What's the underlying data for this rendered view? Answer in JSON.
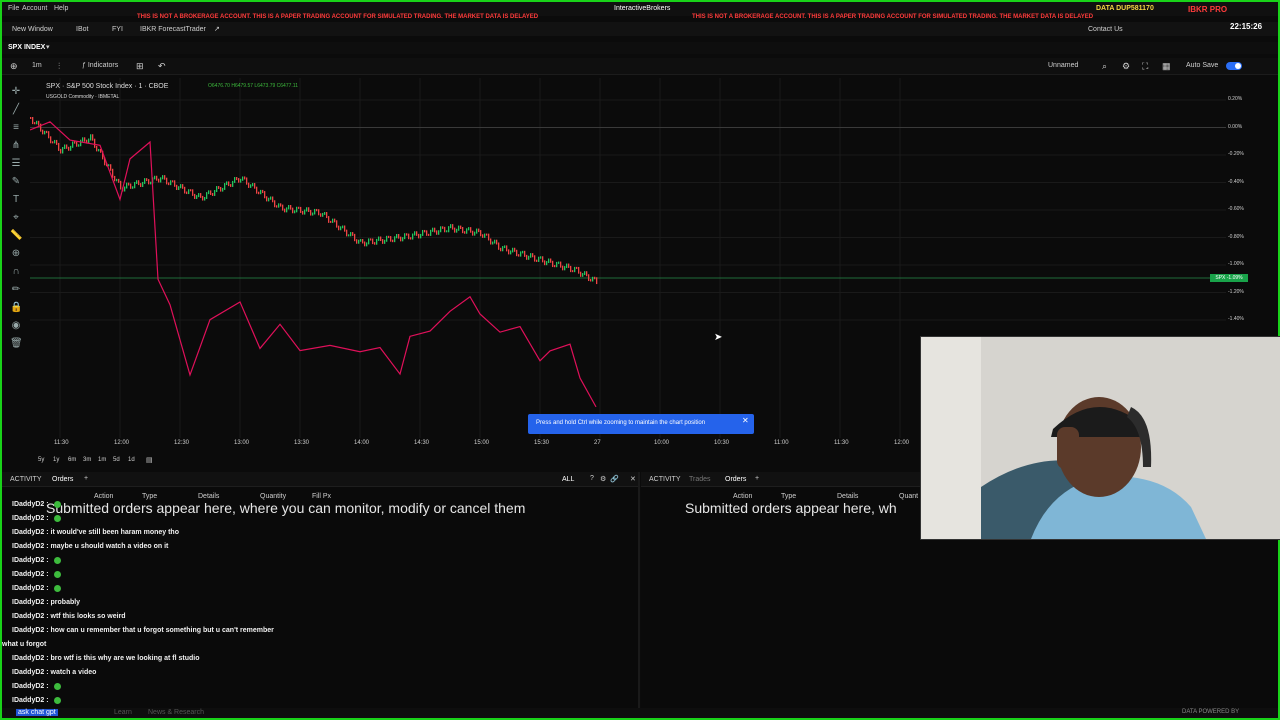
{
  "menubar": {
    "items": [
      "File",
      "Account",
      "Help"
    ],
    "app_title": "InteractiveBrokers",
    "banner": "THIS IS NOT A BROKERAGE ACCOUNT. THIS IS A PAPER TRADING ACCOUNT FOR SIMULATED TRADING. THE MARKET DATA IS DELAYED",
    "data_account": "DATA DUP581170",
    "brand": "IBKR PRO",
    "clock": "22:15:26"
  },
  "toolbar": {
    "items": [
      "New Window",
      "IBot",
      "FYI",
      "IBKR ForecastTrader"
    ],
    "contact": "Contact Us"
  },
  "tab": {
    "label": "SPX INDEX"
  },
  "chart_toolbar": {
    "interval": "1m",
    "indicators": "Indicators",
    "layout_name": "Unnamed",
    "autosave": "Auto Save"
  },
  "legend": {
    "main": "SPX · S&P 500 Stock Index · 1 · CBOE",
    "ohlc": "O6476.70  H6479.57  L6473.79  C6477.11",
    "overlay": "USGOLD Commodity · IBMETAL"
  },
  "price_scale": [
    "0.20%",
    "0.00%",
    "-0.20%",
    "-0.40%",
    "-0.60%",
    "-0.80%",
    "-1.00%",
    "-1.20%",
    "-1.40%"
  ],
  "price_tag": "SPX -1.09%",
  "time_axis": [
    "11:30",
    "12:00",
    "12:30",
    "13:00",
    "13:30",
    "14:00",
    "14:30",
    "15:00",
    "15:30",
    "27",
    "10:00",
    "10:30",
    "11:00",
    "11:30",
    "12:00"
  ],
  "range_buttons": [
    "5y",
    "1y",
    "6m",
    "3m",
    "1m",
    "5d",
    "1d"
  ],
  "tooltip": "Press and hold Ctrl while zooming to maintain the chart position",
  "left_panel": {
    "tabs": [
      "ACTIVITY",
      "Orders"
    ],
    "filter": "ALL",
    "columns": [
      "Action",
      "Type",
      "Details",
      "Quantity",
      "Fill Px"
    ],
    "empty_message": "Submitted orders appear here, where you can monitor, modify or cancel them"
  },
  "right_panel": {
    "tabs": [
      "ACTIVITY",
      "Trades",
      "Orders"
    ],
    "columns": [
      "Action",
      "Type",
      "Details",
      "Quant"
    ],
    "empty_message": "Submitted orders appear here, wh"
  },
  "chat": [
    {
      "user": "IDaddyD2 :",
      "msg": "",
      "emote": true
    },
    {
      "user": "IDaddyD2 :",
      "msg": "",
      "emote": true
    },
    {
      "user": "IDaddyD2 :",
      "msg": "it would've still been haram money tho",
      "emote": false
    },
    {
      "user": "IDaddyD2 :",
      "msg": "maybe u should watch a video on it",
      "emote": false
    },
    {
      "user": "IDaddyD2 :",
      "msg": "",
      "emote": true
    },
    {
      "user": "IDaddyD2 :",
      "msg": "",
      "emote": true
    },
    {
      "user": "IDaddyD2 :",
      "msg": "",
      "emote": true
    },
    {
      "user": "IDaddyD2 :",
      "msg": "probably",
      "emote": false
    },
    {
      "user": "IDaddyD2 :",
      "msg": "wtf this looks so weird",
      "emote": false
    },
    {
      "user": "IDaddyD2 :",
      "msg": "how can u remember that u forgot something but u can't remember",
      "emote": false
    },
    {
      "user": "",
      "msg": "what u forgot",
      "emote": false
    },
    {
      "user": "IDaddyD2 :",
      "msg": "bro wtf is this why are we looking at fl studio",
      "emote": false
    },
    {
      "user": "IDaddyD2 :",
      "msg": "watch a video",
      "emote": false
    },
    {
      "user": "IDaddyD2 :",
      "msg": "",
      "emote": true
    },
    {
      "user": "IDaddyD2 :",
      "msg": "",
      "emote": true
    }
  ],
  "statusbar": {
    "tabs": [
      "ask chat gpt",
      "Learn",
      "News & Research"
    ],
    "right": "DATA POWERED BY"
  },
  "colors": {
    "frame": "#19d219",
    "candle_up": "#22c55e",
    "candle_down": "#ef4444",
    "gold_line": "#e0105a",
    "tooltip": "#2563eb",
    "banner": "#ff3b3b"
  }
}
